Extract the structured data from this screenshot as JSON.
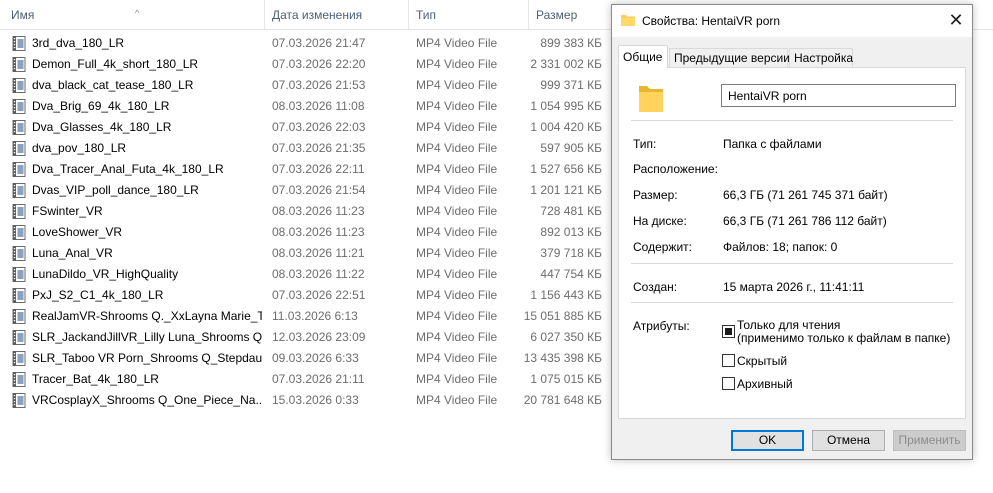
{
  "explorer": {
    "columns": {
      "name": "Имя",
      "date": "Дата изменения",
      "type": "Тип",
      "size": "Размер"
    },
    "files": [
      {
        "name": "3rd_dva_180_LR",
        "date": "07.03.2026 21:47",
        "type": "MP4 Video File",
        "size": "899 383 КБ"
      },
      {
        "name": "Demon_Full_4k_short_180_LR",
        "date": "07.03.2026 22:20",
        "type": "MP4 Video File",
        "size": "2 331 002 КБ"
      },
      {
        "name": "dva_black_cat_tease_180_LR",
        "date": "07.03.2026 21:53",
        "type": "MP4 Video File",
        "size": "999 371 КБ"
      },
      {
        "name": "Dva_Brig_69_4k_180_LR",
        "date": "08.03.2026 11:08",
        "type": "MP4 Video File",
        "size": "1 054 995 КБ"
      },
      {
        "name": "Dva_Glasses_4k_180_LR",
        "date": "07.03.2026 22:03",
        "type": "MP4 Video File",
        "size": "1 004 420 КБ"
      },
      {
        "name": "dva_pov_180_LR",
        "date": "07.03.2026 21:35",
        "type": "MP4 Video File",
        "size": "597 905 КБ"
      },
      {
        "name": "Dva_Tracer_Anal_Futa_4k_180_LR",
        "date": "07.03.2026 22:11",
        "type": "MP4 Video File",
        "size": "1 527 656 КБ"
      },
      {
        "name": "Dvas_VIP_poll_dance_180_LR",
        "date": "07.03.2026 21:54",
        "type": "MP4 Video File",
        "size": "1 201 121 КБ"
      },
      {
        "name": "FSwinter_VR",
        "date": "08.03.2026 11:23",
        "type": "MP4 Video File",
        "size": "728 481 КБ"
      },
      {
        "name": "LoveShower_VR",
        "date": "08.03.2026 11:23",
        "type": "MP4 Video File",
        "size": "892 013 КБ"
      },
      {
        "name": "Luna_Anal_VR",
        "date": "08.03.2026 11:21",
        "type": "MP4 Video File",
        "size": "379 718 КБ"
      },
      {
        "name": "LunaDildo_VR_HighQuality",
        "date": "08.03.2026 11:22",
        "type": "MP4 Video File",
        "size": "447 754 КБ"
      },
      {
        "name": "PxJ_S2_C1_4k_180_LR",
        "date": "07.03.2026 22:51",
        "type": "MP4 Video File",
        "size": "1 156 443 КБ"
      },
      {
        "name": "RealJamVR-Shrooms Q._XxLayna Marie_T...",
        "date": "11.03.2026 6:13",
        "type": "MP4 Video File",
        "size": "15 051 885 КБ"
      },
      {
        "name": "SLR_JackandJillVR_Lilly Luna_Shrooms Q...",
        "date": "12.03.2026 23:09",
        "type": "MP4 Video File",
        "size": "6 027 350 КБ"
      },
      {
        "name": "SLR_Taboo VR Porn_Shrooms Q_Stepdau...",
        "date": "09.03.2026 6:33",
        "type": "MP4 Video File",
        "size": "13 435 398 КБ"
      },
      {
        "name": "Tracer_Bat_4k_180_LR",
        "date": "07.03.2026 21:11",
        "type": "MP4 Video File",
        "size": "1 075 015 КБ"
      },
      {
        "name": "VRCosplayX_Shrooms Q_One_Piece_Na...",
        "date": "15.03.2026 0:33",
        "type": "MP4 Video File",
        "size": "20 781 648 КБ"
      }
    ]
  },
  "dialog": {
    "title": "Свойства: HentaiVR porn",
    "close_glyph": "✕",
    "tabs": {
      "general": "Общие",
      "previous": "Предыдущие версии",
      "settings": "Настройка"
    },
    "folder_name": "HentaiVR porn",
    "type_label": "Тип:",
    "type_value": "Папка с файлами",
    "location_label": "Расположение:",
    "location_value": "",
    "size_label": "Размер:",
    "size_value": "66,3 ГБ (71 261 745 371 байт)",
    "disk_label": "На диске:",
    "disk_value": "66,3 ГБ (71 261 786 112 байт)",
    "contains_label": "Содержит:",
    "contains_value": "Файлов: 18; папок: 0",
    "created_label": "Создан:",
    "created_value": "15 марта 2026 г., 11:41:11",
    "attributes_label": "Атрибуты:",
    "readonly_label_1": "Только для чтения",
    "readonly_label_2": "(применимо только к файлам в папке)",
    "hidden_label": "Скрытый",
    "archive_label": "Архивный",
    "ok": "OK",
    "cancel": "Отмена",
    "apply": "Применить"
  },
  "colors": {
    "header_text": "#4c607a",
    "secondary_text": "#6d6d6d",
    "folder_yellow": "#f8cf5a",
    "accent_blue": "#0078d7"
  }
}
